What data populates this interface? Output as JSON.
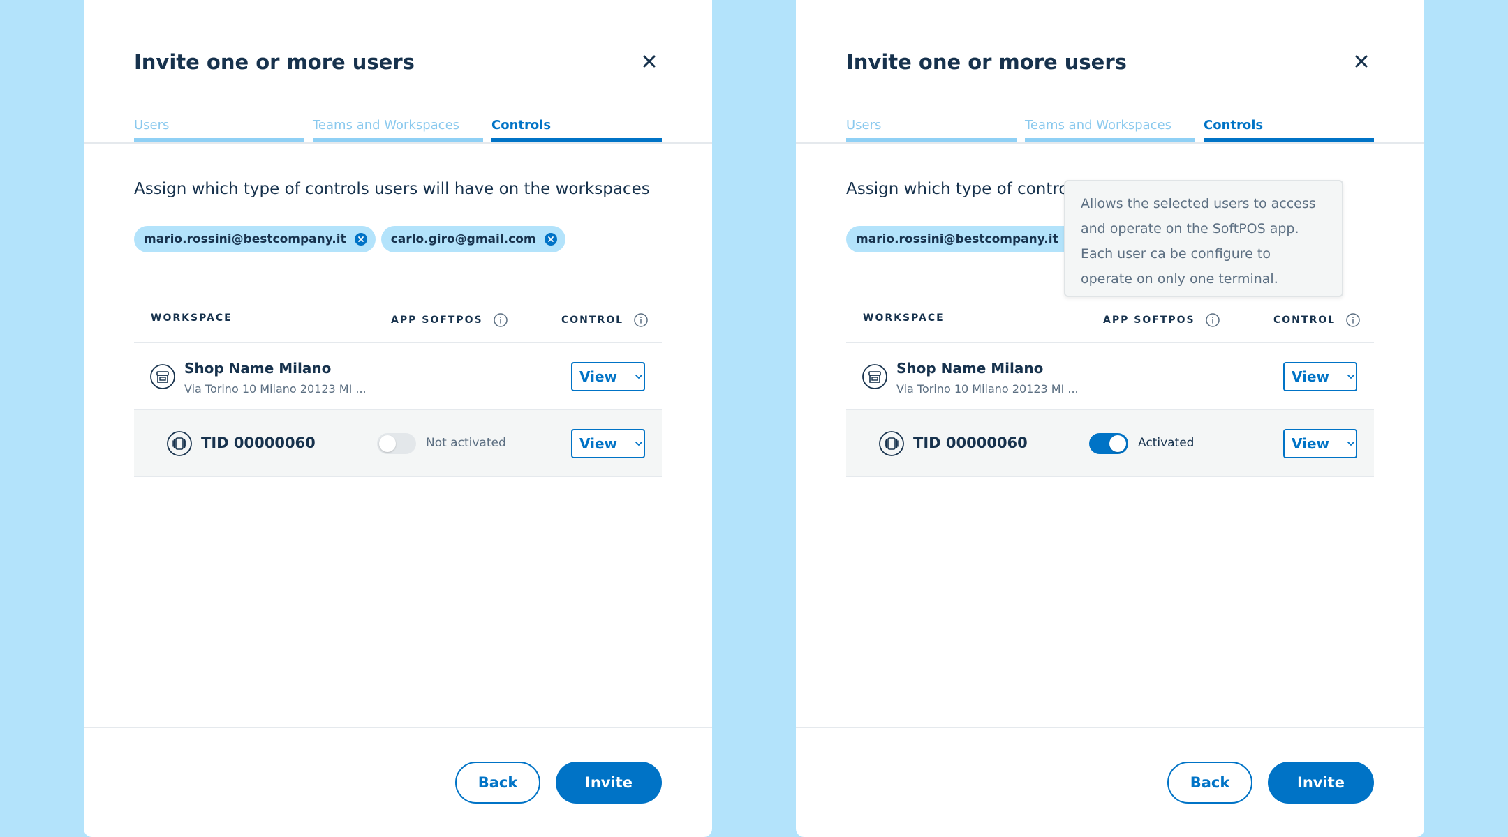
{
  "panels": [
    {
      "title": "Invite one or more users",
      "tabs": [
        "Users",
        "Teams and Workspaces",
        "Controls"
      ],
      "active_tab": "Controls",
      "description": "Assign which type of controls users will have on the workspaces",
      "chips": [
        "mario.rossini@bestcompany.it",
        "carlo.giro@gmail.com"
      ],
      "table": {
        "headers": {
          "workspace": "WORKSPACE",
          "softpos": "APP SOFTPOS",
          "control": "CONTROL"
        },
        "shop": {
          "name": "Shop Name Milano",
          "address": "Via Torino 10 Milano 20123 MI ...",
          "control": "View"
        },
        "terminal": {
          "name": "TID 00000060",
          "softpos_enabled": false,
          "softpos_status": "Not activated",
          "control": "View"
        }
      },
      "buttons": {
        "back": "Back",
        "invite": "Invite"
      }
    },
    {
      "title": "Invite one or more users",
      "tabs": [
        "Users",
        "Teams and Workspaces",
        "Controls"
      ],
      "active_tab": "Controls",
      "description": "Assign which type of control",
      "chips": [
        "mario.rossini@bestcompany.it"
      ],
      "tooltip": [
        "Allows the selected users to access",
        "and operate on the SoftPOS app.",
        "Each user ca be configure to",
        "operate on only one terminal."
      ],
      "table": {
        "headers": {
          "workspace": "WORKSPACE",
          "softpos": "APP SOFTPOS",
          "control": "CONTROL"
        },
        "shop": {
          "name": "Shop Name Milano",
          "address": "Via Torino 10 Milano 20123 MI ...",
          "control": "View"
        },
        "terminal": {
          "name": "TID 00000060",
          "softpos_enabled": true,
          "softpos_status": "Activated",
          "control": "View"
        }
      },
      "buttons": {
        "back": "Back",
        "invite": "Invite"
      }
    }
  ],
  "colors": {
    "background": "#b3e3fb",
    "primary": "#0073c6",
    "text": "#17324d",
    "muted": "#5c6f82",
    "chip": "#b3e3fb",
    "tab_inactive": "#8fd0f5"
  },
  "icons": [
    "close-icon",
    "remove-chip-icon",
    "info-icon",
    "store-icon",
    "terminal-icon",
    "chevron-down-icon"
  ]
}
